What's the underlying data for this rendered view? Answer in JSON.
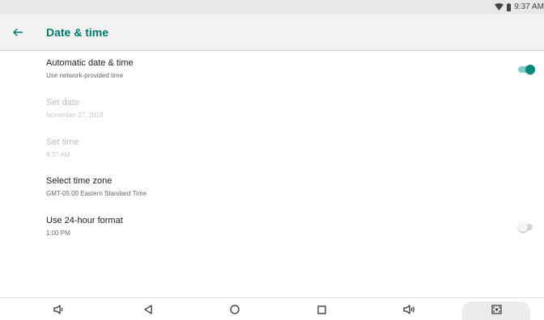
{
  "status_bar": {
    "time": "9:37 AM"
  },
  "app_bar": {
    "title": "Date & time"
  },
  "settings": [
    {
      "title": "Automatic date & time",
      "summary": "Use network-provided time",
      "toggle": true
    },
    {
      "title": "Set date",
      "summary": "November 27, 2018",
      "disabled": true
    },
    {
      "title": "Set time",
      "summary": "9:37 AM",
      "disabled": true
    },
    {
      "title": "Select time zone",
      "summary": "GMT-05:00 Eastern Standard Time"
    },
    {
      "title": "Use 24-hour format",
      "summary": "1:00 PM",
      "toggle": false
    }
  ],
  "colors": {
    "accent": "#00796b",
    "switch_thumb_on": "#00897b",
    "switch_track_on": "#80cbc4"
  },
  "nav_bar": {
    "icons": [
      "volume-down-icon",
      "back-icon",
      "home-icon",
      "recents-icon",
      "volume-up-icon",
      "screenshot-icon"
    ]
  }
}
